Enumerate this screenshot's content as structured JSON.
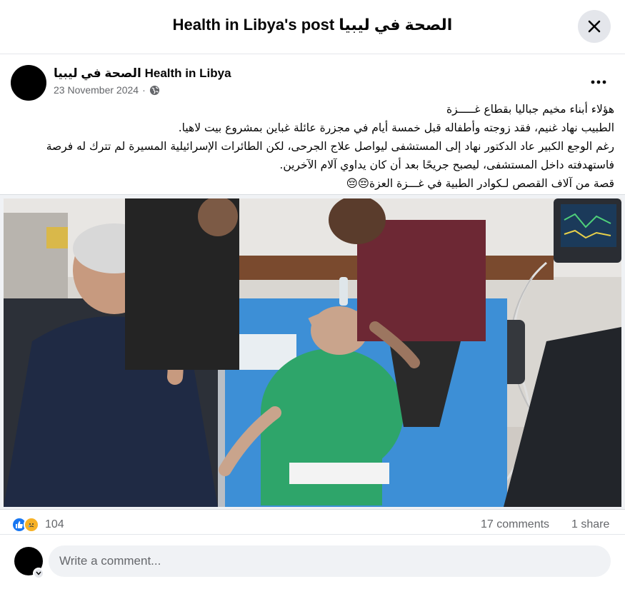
{
  "dialog": {
    "title": "Health in Libya's post الصحة في ليبيا"
  },
  "post": {
    "page_name": "الصحة في ليبيا Health in Libya",
    "date": "23 November 2024",
    "separator": "·",
    "privacy_icon": "globe-icon",
    "more_icon": "more-horizontal-icon",
    "text_lines": [
      "هؤلاء أبناء مخيم جباليا بقطاع غـــــزة",
      "الطبيب نهاد غنيم، فقد زوجته وأطفاله قبل خمسة أيام في مجزرة عائلة غباين بمشروع بيت لاهيا.",
      "رغم الوجع الكبير  عاد الدكتور نهاد إلى المستشفى ليواصل علاج الجرحى، لكن الطائرات الإسرائيلية المسيرة لم تترك له فرصة فاستهدفته داخل المستشفى، ليصبح جريحًا بعد أن كان يداوي آلام الآخرين.",
      "قصة من آلاف القصص لـكوادر الطبية في غـــزة العزة😔😔"
    ]
  },
  "stats": {
    "reaction_icons": [
      "like-icon",
      "care-icon"
    ],
    "reaction_count": "104",
    "comments": "17 comments",
    "shares": "1 share"
  },
  "composer": {
    "placeholder": "Write a comment...",
    "badge_icon": "chevron-down-icon"
  },
  "colors": {
    "accent": "#1877f2",
    "secondary_text": "#65676b",
    "surface": "#f0f2f5"
  }
}
